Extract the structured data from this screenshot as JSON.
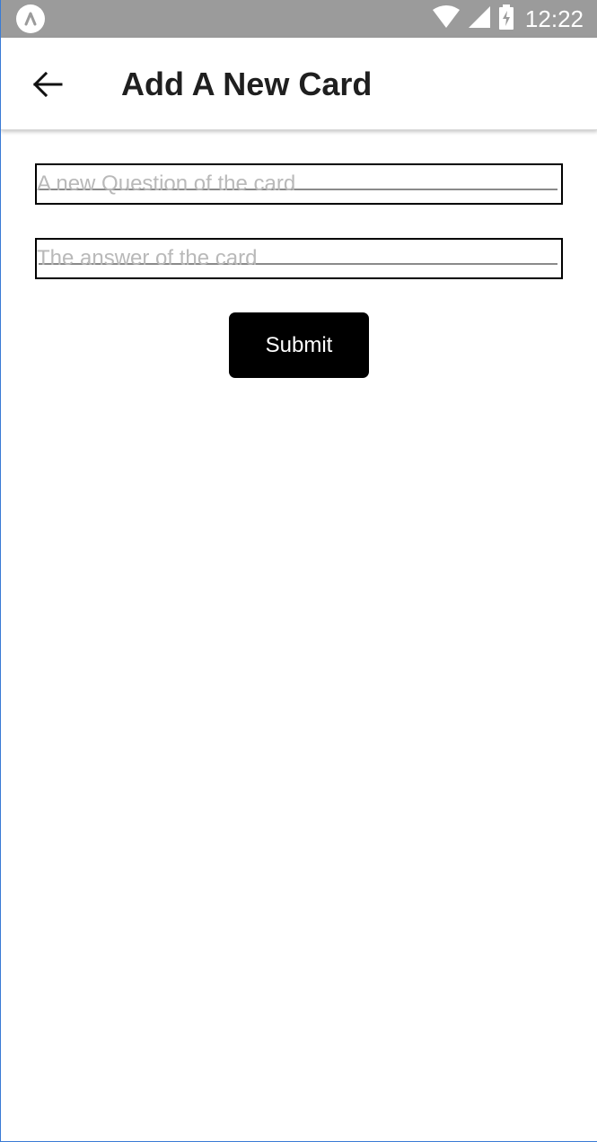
{
  "status_bar": {
    "time": "12:22",
    "icons": [
      "expo-icon",
      "wifi-icon",
      "signal-icon",
      "battery-charging-icon"
    ],
    "background": "#9b9b9b"
  },
  "header": {
    "title": "Add A New Card",
    "back_icon": "arrow-left-icon"
  },
  "form": {
    "question_placeholder": "A new Question of the card",
    "question_value": "",
    "answer_placeholder": "The answer of the card",
    "answer_value": "",
    "submit_label": "Submit",
    "submit_color": "#000000"
  }
}
